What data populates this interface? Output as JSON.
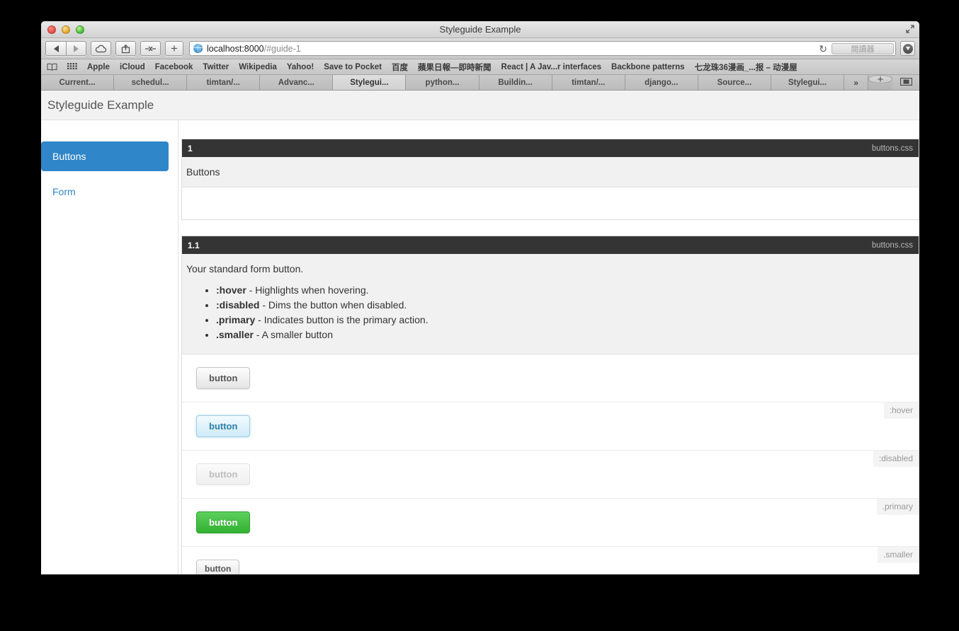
{
  "window": {
    "title": "Styleguide Example",
    "expand_icon": "expand-icon"
  },
  "toolbar": {
    "back_icon": "back-arrow-icon",
    "forward_icon": "forward-arrow-icon",
    "icloud_icon": "cloud-icon",
    "share_icon": "share-icon",
    "sidebar_icon": "show-all-tabs-icon",
    "new_tab_icon": "plus-icon",
    "site_icon": "globe-icon",
    "url_main": "localhost:8000",
    "url_rest": "/#guide-1",
    "reload_icon": "reload-icon",
    "reader_label": "閱讀器",
    "downloads_icon": "downloads-icon"
  },
  "bookmarks": {
    "book_icon": "book-icon",
    "grid_icon": "top-sites-grid-icon",
    "items": [
      "Apple",
      "iCloud",
      "Facebook",
      "Twitter",
      "Wikipedia",
      "Yahoo!",
      "Save to Pocket",
      "百度",
      "蘋果日報—即時新聞",
      "React | A Jav...r interfaces",
      "Backbone patterns",
      "七龙珠36漫画_...报 – 动漫屋"
    ]
  },
  "tabs": {
    "items": [
      {
        "label": "Current...",
        "active": false
      },
      {
        "label": "schedul...",
        "active": false
      },
      {
        "label": "timtan/...",
        "active": false
      },
      {
        "label": "Advanc...",
        "active": false
      },
      {
        "label": "Stylegui...",
        "active": true
      },
      {
        "label": "python...",
        "active": false
      },
      {
        "label": "Buildin...",
        "active": false
      },
      {
        "label": "timtan/...",
        "active": false
      },
      {
        "label": "django...",
        "active": false
      },
      {
        "label": "Source...",
        "active": false
      },
      {
        "label": "Stylegui...",
        "active": false
      }
    ],
    "overflow_label": "»",
    "new_tab_label": "+",
    "tab_overview_icon": "tab-overview-icon"
  },
  "page": {
    "title": "Styleguide Example",
    "sidebar": {
      "items": [
        {
          "label": "Buttons",
          "active": true
        },
        {
          "label": "Form",
          "active": false
        }
      ]
    },
    "sections": [
      {
        "number": "1",
        "file": "buttons.css",
        "heading": "Buttons",
        "bullets": [],
        "examples": []
      },
      {
        "number": "1.1",
        "file": "buttons.css",
        "heading": "Your standard form button.",
        "bullets": [
          {
            "modifier": ":hover",
            "text": " - Highlights when hovering."
          },
          {
            "modifier": ":disabled",
            "text": " - Dims the button when disabled."
          },
          {
            "modifier": ".primary",
            "text": " - Indicates button is the primary action."
          },
          {
            "modifier": ".smaller",
            "text": " - A smaller button"
          }
        ],
        "examples": [
          {
            "label": "button",
            "modifier": "",
            "variant": "default"
          },
          {
            "label": "button",
            "modifier": ":hover",
            "variant": "hover"
          },
          {
            "label": "button",
            "modifier": ":disabled",
            "variant": "disabled"
          },
          {
            "label": "button",
            "modifier": ".primary",
            "variant": "primary"
          },
          {
            "label": "button",
            "modifier": ".smaller",
            "variant": "smaller"
          }
        ]
      }
    ]
  },
  "colors": {
    "accent": "#2f86c8",
    "primary_button": "#31b131",
    "section_header": "#343434",
    "link": "#2f86c8"
  }
}
